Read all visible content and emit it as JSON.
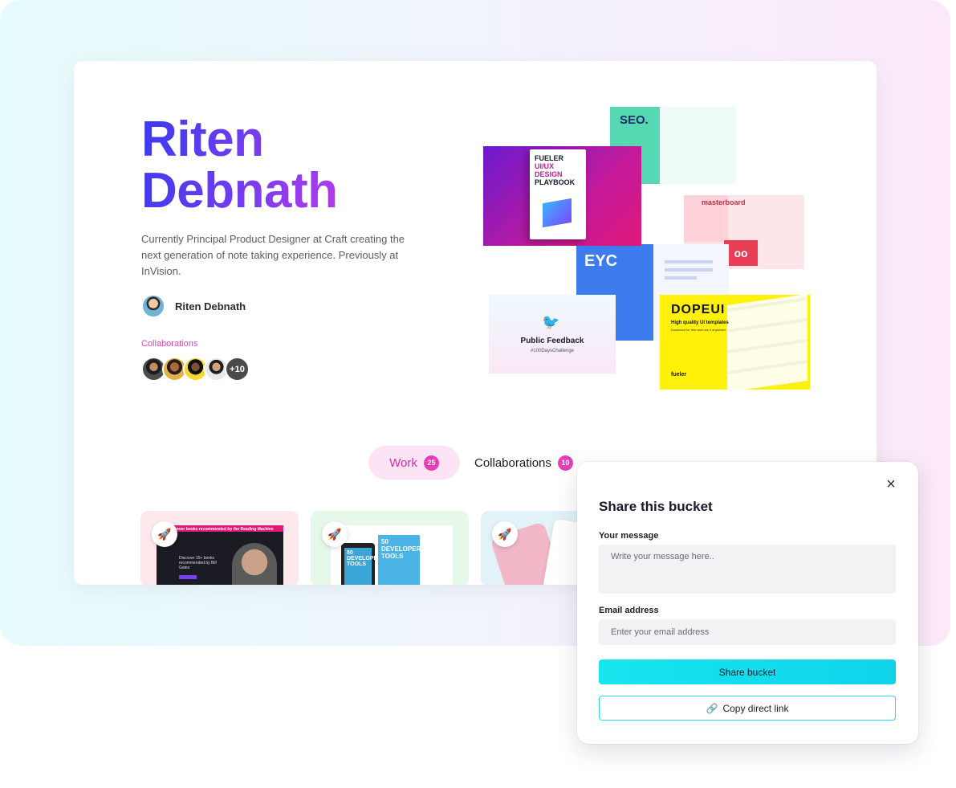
{
  "profile": {
    "name_line1": "Riten",
    "name_line2": "Debnath",
    "bio": "Currently Principal Product Designer at Craft creating the next generation of note taking experience. Previously at InVision.",
    "author_name": "Riten Debnath",
    "collaborations_label": "Collaborations",
    "collaborators_more": "+10"
  },
  "collage": {
    "seo_logo": "SEO.",
    "playbook_line1": "FUELER",
    "playbook_line2": "UI/UX DESIGN",
    "playbook_line3": "PLAYBOOK",
    "masterboard_label": "masterboard",
    "eyc_logo": "EYC",
    "twitter_title": "Public Feedback",
    "twitter_tag": "#100DaysChallenge",
    "dopeui_logo": "DOPEUI",
    "dopeui_sub": "High quality UI templates",
    "dopeui_sub2": "Download for free and use it anywhere",
    "dopeui_brand": "fueler"
  },
  "tabs": [
    {
      "label": "Work",
      "count": "25",
      "active": true
    },
    {
      "label": "Collaborations",
      "count": "10",
      "active": false
    }
  ],
  "work_cards": {
    "card1_title": "cover books recommended by the Reading Machine",
    "card1_text": "Discover 15+ books recommended by Bill Gates",
    "card2_tablet": "50 DEVELOPER TOOLS",
    "card2_book": "50 DEVELOPER TOOLS"
  },
  "share_modal": {
    "title": "Share this bucket",
    "message_label": "Your message",
    "message_placeholder": "Write your message here..",
    "email_label": "Email address",
    "email_placeholder": "Enter your email address",
    "share_button": "Share bucket",
    "copy_button": "Copy direct link",
    "close_symbol": "×"
  },
  "colors": {
    "accent_pink": "#e43fb8",
    "accent_cyan": "#16e6ee",
    "name_gradient_start": "#3b3bf0",
    "name_gradient_end": "#b23cea"
  },
  "icons": [
    "rocket-icon",
    "link-icon",
    "close-icon",
    "twitter-bird-icon"
  ]
}
